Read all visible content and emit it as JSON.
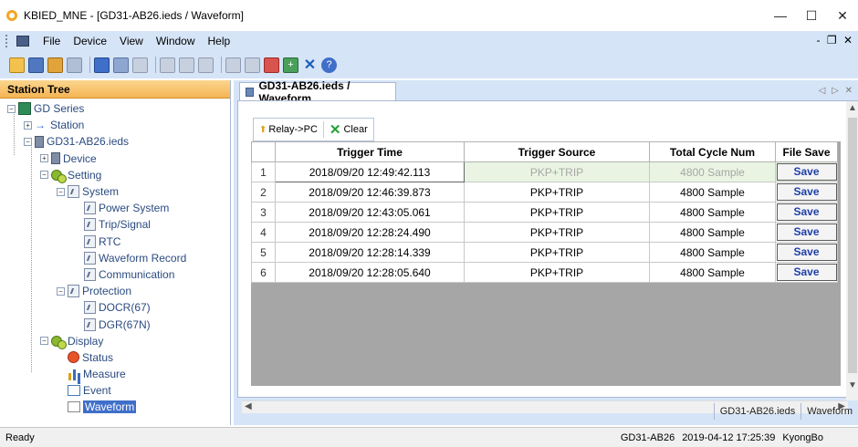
{
  "window": {
    "title": "KBIED_MNE - [GD31-AB26.ieds / Waveform]",
    "minimize": "—",
    "maximize": "☐",
    "close": "✕"
  },
  "menubar": {
    "items": [
      "File",
      "Device",
      "View",
      "Window",
      "Help"
    ],
    "right_controls": "- ❐ ✕"
  },
  "toolbar": {
    "icons": [
      "open-folder-icon",
      "save-icon",
      "connect-icon",
      "disconnect-icon",
      "settings-list-icon",
      "rtc-icon",
      "power-icon",
      "search-icon",
      "print-icon",
      "grid-icon",
      "window-icon",
      "swap-icon",
      "scale-icon",
      "add-icon",
      "delete-icon",
      "help-icon"
    ]
  },
  "station_tree": {
    "header": "Station Tree",
    "nodes": [
      {
        "label": "GD Series"
      },
      {
        "label": "Station"
      },
      {
        "label": "GD31-AB26.ieds"
      },
      {
        "label": "Device"
      },
      {
        "label": "Setting"
      },
      {
        "label": "System"
      },
      {
        "label": "Power System"
      },
      {
        "label": "Trip/Signal"
      },
      {
        "label": "RTC"
      },
      {
        "label": "Waveform Record"
      },
      {
        "label": "Communication"
      },
      {
        "label": "Protection"
      },
      {
        "label": "DOCR(67)"
      },
      {
        "label": "DGR(67N)"
      },
      {
        "label": "Display"
      },
      {
        "label": "Status"
      },
      {
        "label": "Measure"
      },
      {
        "label": "Event"
      },
      {
        "label": "Waveform"
      }
    ]
  },
  "document": {
    "tab_label": "GD31-AB26.ieds / Waveform",
    "tab_nav": "◁ ▷ ✕",
    "relay_button": "Relay->PC",
    "clear_button": "Clear",
    "columns": [
      "",
      "Trigger Time",
      "Trigger Source",
      "Total Cycle Num",
      "File Save"
    ],
    "rows": [
      {
        "n": "1",
        "time": "2018/09/20 12:49:42.113",
        "source": "PKP+TRIP",
        "cycles": "4800 Sample",
        "save": "Save"
      },
      {
        "n": "2",
        "time": "2018/09/20 12:46:39.873",
        "source": "PKP+TRIP",
        "cycles": "4800 Sample",
        "save": "Save"
      },
      {
        "n": "3",
        "time": "2018/09/20 12:43:05.061",
        "source": "PKP+TRIP",
        "cycles": "4800 Sample",
        "save": "Save"
      },
      {
        "n": "4",
        "time": "2018/09/20 12:28:24.490",
        "source": "PKP+TRIP",
        "cycles": "4800 Sample",
        "save": "Save"
      },
      {
        "n": "5",
        "time": "2018/09/20 12:28:14.339",
        "source": "PKP+TRIP",
        "cycles": "4800 Sample",
        "save": "Save"
      },
      {
        "n": "6",
        "time": "2018/09/20 12:28:05.640",
        "source": "PKP+TRIP",
        "cycles": "4800 Sample",
        "save": "Save"
      }
    ],
    "bottom_tabs": [
      "GD31-AB26.ieds",
      "Waveform"
    ]
  },
  "statusbar": {
    "left": "Ready",
    "device": "GD31-AB26",
    "datetime": "2019-04-12 17:25:39",
    "user": "KyongBo"
  }
}
